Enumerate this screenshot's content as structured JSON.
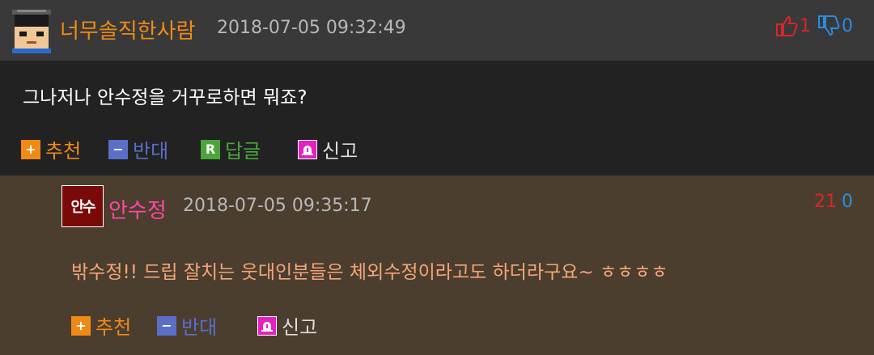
{
  "comments": [
    {
      "author": "너무솔직한사람",
      "date": "2018-07-05 09:32:49",
      "text": "그나저나 안수정을 거꾸로하면 뭐죠?",
      "likes": "1",
      "dislikes": "0",
      "actions": {
        "recommend": "추천",
        "oppose": "반대",
        "reply": "답글",
        "reply_icon": "R",
        "report": "신고"
      }
    },
    {
      "author": "안수정",
      "avatar_text": "안수",
      "date": "2018-07-05 09:35:17",
      "text": "밖수정!! 드립 잘치는 웃대인분들은 체외수정이라고도 하더라구요~ ㅎㅎㅎㅎ",
      "likes": "21",
      "dislikes": "0",
      "actions": {
        "recommend": "추천",
        "oppose": "반대",
        "report": "신고"
      }
    }
  ],
  "colors": {
    "author1": "#f08a16",
    "author2": "#ff4aa0",
    "text1": "#ffffff",
    "text2": "#f5a57a",
    "like": "#d8262c",
    "dislike": "#2b8ce0",
    "recommend": "#f08a16",
    "oppose": "#5b6ec8",
    "reply": "#4aa63a",
    "report": "#e620c0"
  },
  "icons": [
    "avatar-pixel-face",
    "thumbs-up-icon",
    "thumbs-down-icon",
    "plus-icon",
    "minus-icon",
    "reply-icon",
    "siren-icon"
  ]
}
